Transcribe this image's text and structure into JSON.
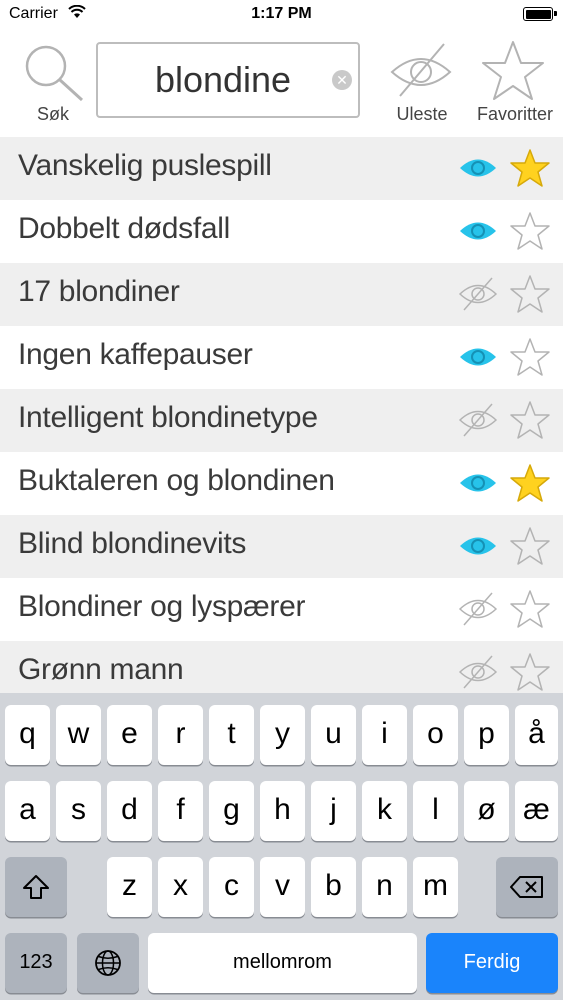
{
  "status_bar": {
    "carrier": "Carrier",
    "time": "1:17 PM"
  },
  "toolbar": {
    "search_label": "Søk",
    "search_value": "blondine",
    "unread_label": "Uleste",
    "favorites_label": "Favoritter"
  },
  "colors": {
    "eye_active": "#27c3ea",
    "eye_inactive": "#b3b3b3",
    "star_active": "#ffd21f",
    "star_inactive": "#b3b3b3",
    "accent": "#1a84fb"
  },
  "items": [
    {
      "title": "Vanskelig puslespill",
      "seen": true,
      "favorite": true
    },
    {
      "title": "Dobbelt dødsfall",
      "seen": true,
      "favorite": false
    },
    {
      "title": "17 blondiner",
      "seen": false,
      "favorite": false
    },
    {
      "title": "Ingen kaffepauser",
      "seen": true,
      "favorite": false
    },
    {
      "title": "Intelligent blondinetype",
      "seen": false,
      "favorite": false
    },
    {
      "title": "Buktaleren og blondinen",
      "seen": true,
      "favorite": true
    },
    {
      "title": "Blind blondinevits",
      "seen": true,
      "favorite": false
    },
    {
      "title": "Blondiner og lyspærer",
      "seen": false,
      "favorite": false
    },
    {
      "title": "Grønn mann",
      "seen": false,
      "favorite": false
    }
  ],
  "keyboard": {
    "row1": [
      "q",
      "w",
      "e",
      "r",
      "t",
      "y",
      "u",
      "i",
      "o",
      "p",
      "å"
    ],
    "row2": [
      "a",
      "s",
      "d",
      "f",
      "g",
      "h",
      "j",
      "k",
      "l",
      "ø",
      "æ"
    ],
    "row3": [
      "z",
      "x",
      "c",
      "v",
      "b",
      "n",
      "m"
    ],
    "numbers_label": "123",
    "space_label": "mellomrom",
    "done_label": "Ferdig"
  }
}
